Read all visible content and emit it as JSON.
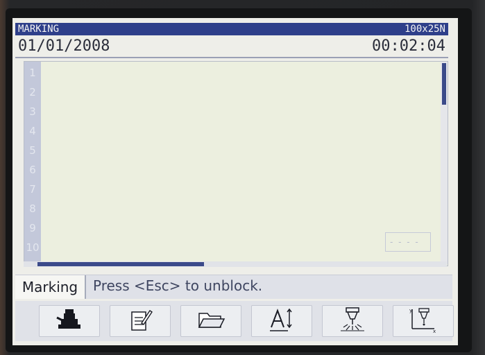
{
  "titlebar": {
    "mode": "MARKING",
    "format": "100x25N"
  },
  "info": {
    "date": "01/01/2008",
    "time": "00:02:04"
  },
  "editor": {
    "line_numbers": [
      "1",
      "2",
      "3",
      "4",
      "5",
      "6",
      "7",
      "8",
      "9",
      "10"
    ],
    "position_box": "- - - -"
  },
  "status": {
    "mode_label": "Marking",
    "message": "Press <Esc> to unblock."
  },
  "toolbar": {
    "buttons": [
      {
        "icon": "stamp-icon"
      },
      {
        "icon": "edit-document-icon"
      },
      {
        "icon": "open-folder-icon"
      },
      {
        "icon": "text-size-icon"
      },
      {
        "icon": "marking-head-icon"
      },
      {
        "icon": "axis-head-icon"
      }
    ]
  },
  "colors": {
    "titlebar_bg": "#2e3f8a",
    "screen_bg": "#eeeee9",
    "gutter_bg": "#c3c8da",
    "accent": "#3b4a8a"
  }
}
